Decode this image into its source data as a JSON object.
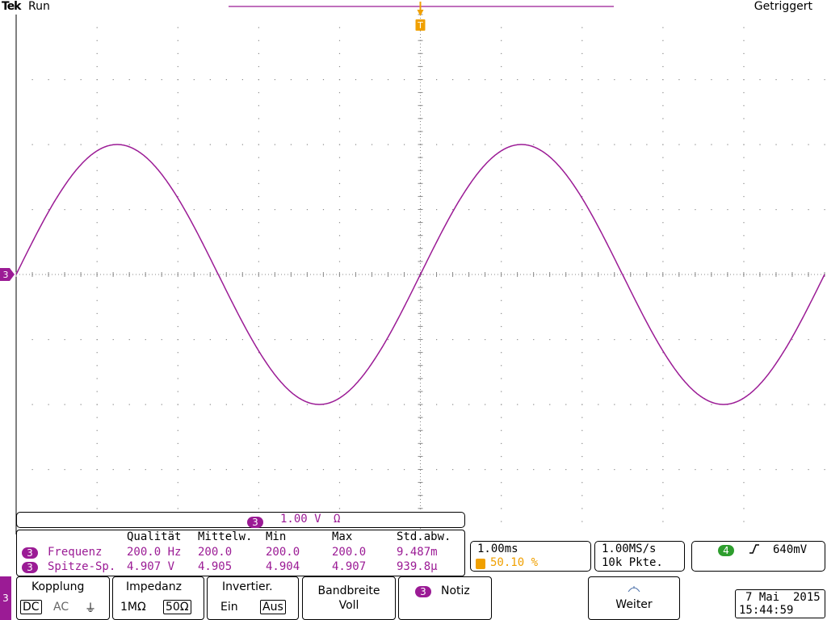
{
  "header": {
    "brand": "Tek",
    "status": "Run",
    "trigger_status": "Getriggert"
  },
  "waveform": {
    "channel": "3",
    "trigger_marker": "T",
    "color": "#9b1b95",
    "grid_color": "#8a8a8a",
    "cycles_on_screen": 2,
    "amplitude_divisions": 2.0
  },
  "channel_scale": {
    "chip": "3",
    "value": "1.00 V",
    "unit": "Ω"
  },
  "measurements": {
    "headers": [
      "Qualität",
      "Mittelw.",
      "Min",
      "Max",
      "Std.abw."
    ],
    "rows": [
      {
        "chip": "3",
        "name": "Frequenz",
        "values": [
          "200.0 Hz",
          "200.0",
          "200.0",
          "200.0",
          "9.487m"
        ]
      },
      {
        "chip": "3",
        "name": "Spitze-Sp.",
        "values": [
          "4.907 V",
          "4.905",
          "4.904",
          "4.907",
          "939.8µ"
        ]
      }
    ]
  },
  "timebase": {
    "scale": "1.00ms",
    "trigger_chip": "T",
    "trigger_position": "50.10 %"
  },
  "acquisition": {
    "rate": "1.00MS/s",
    "points": "10k Pkte."
  },
  "trigger": {
    "chip": "4",
    "slope_icon": "rising-edge-icon",
    "level": "640mV"
  },
  "menu": {
    "side_tab": "3",
    "kopplung": {
      "title": "Kopplung",
      "options": [
        "DC",
        "AC",
        "⏚"
      ],
      "selected": "DC"
    },
    "impedanz": {
      "title": "Impedanz",
      "options": [
        "1MΩ",
        "50Ω"
      ],
      "selected": "50Ω"
    },
    "invertier": {
      "title": "Invertier.",
      "options": [
        "Ein",
        "Aus"
      ],
      "selected": "Aus"
    },
    "bandbreite": {
      "title": "Bandbreite",
      "value": "Voll"
    },
    "notiz": {
      "chip": "3",
      "label": "Notiz"
    },
    "weiter": {
      "label": "Weiter"
    }
  },
  "datetime": {
    "date": "7 Mai  2015",
    "time": "15:44:59"
  }
}
